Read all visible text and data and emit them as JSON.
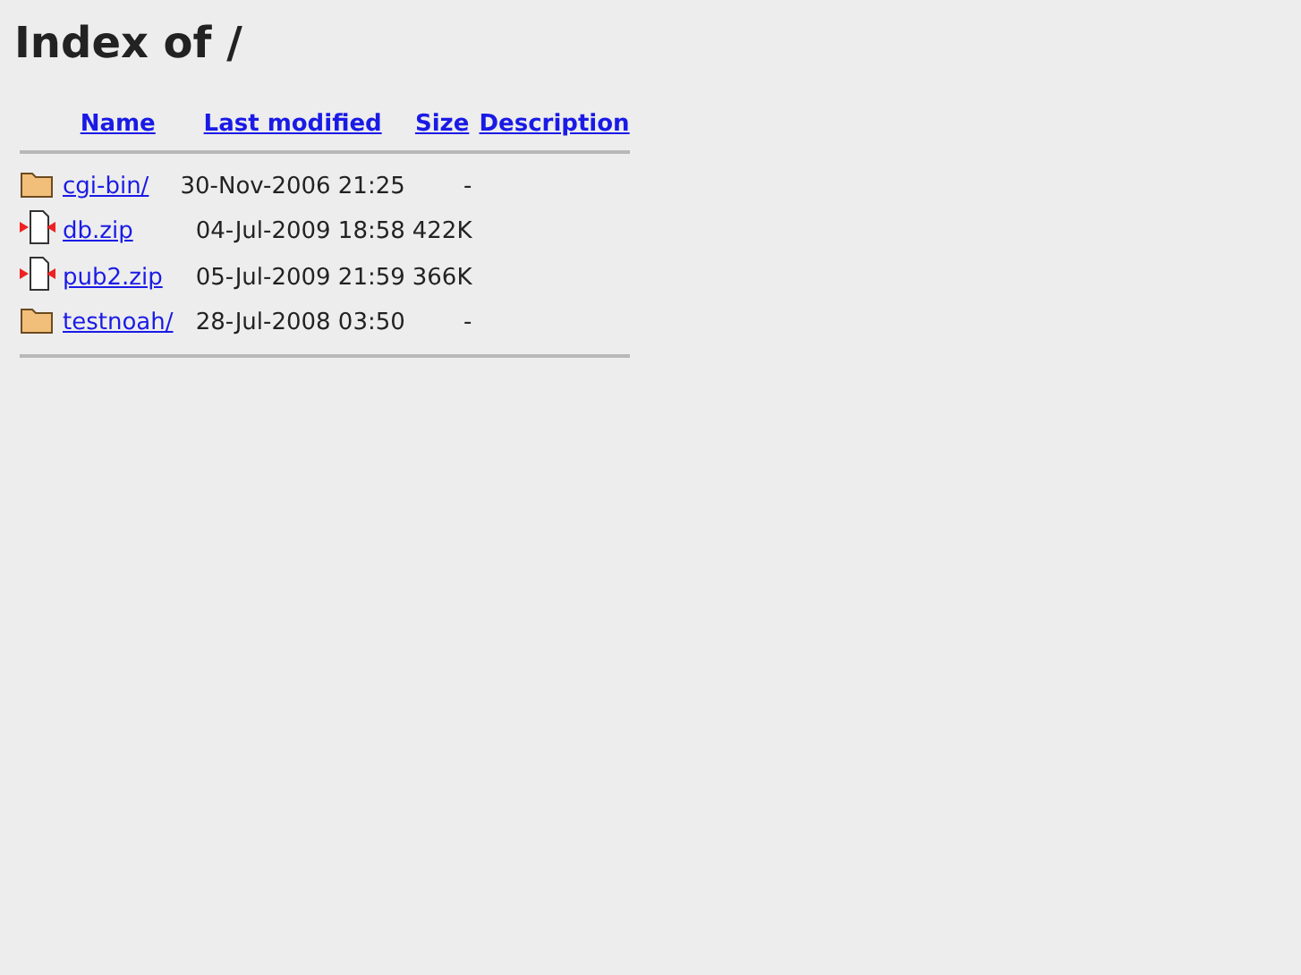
{
  "title": "Index of /",
  "columns": [
    "Name",
    "Last modified",
    "Size",
    "Description"
  ],
  "rows": [
    {
      "kind": "folder",
      "name": "cgi-bin/",
      "modified": "30-Nov-2006 21:25",
      "size": "-"
    },
    {
      "kind": "archive",
      "name": "db.zip",
      "modified": "04-Jul-2009 18:58",
      "size": "422K"
    },
    {
      "kind": "archive",
      "name": "pub2.zip",
      "modified": "05-Jul-2009 21:59",
      "size": "366K"
    },
    {
      "kind": "folder",
      "name": "testnoah/",
      "modified": "28-Jul-2008 03:50",
      "size": "-"
    }
  ]
}
